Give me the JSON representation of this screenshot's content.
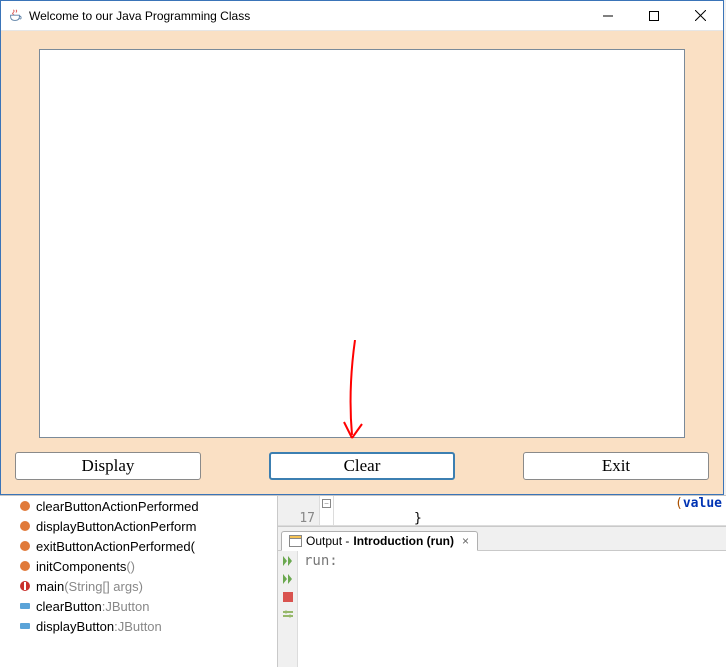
{
  "swing": {
    "title": "Welcome to our Java Programming Class",
    "buttons": {
      "display": "Display",
      "clear": "Clear",
      "exit": "Exit"
    }
  },
  "navigator": {
    "items": [
      {
        "kind": "method",
        "name": "clearButtonActionPerformed",
        "params": ""
      },
      {
        "kind": "method",
        "name": "displayButtonActionPerform",
        "params": ""
      },
      {
        "kind": "method",
        "name": "exitButtonActionPerformed(",
        "params": ""
      },
      {
        "kind": "method",
        "name": "initComponents",
        "params": "()"
      },
      {
        "kind": "main",
        "name": "main",
        "params": "(String[] args)"
      },
      {
        "kind": "field",
        "name": "clearButton",
        "type": "JButton"
      },
      {
        "kind": "field",
        "name": "displayButton",
        "type": "JButton"
      }
    ]
  },
  "editor": {
    "line_no_17": "17",
    "brace": "}",
    "fragment_tail": "(value"
  },
  "output": {
    "tab_prefix": "Output - ",
    "tab_bold": "Introduction (run)",
    "run_text": "run:"
  }
}
